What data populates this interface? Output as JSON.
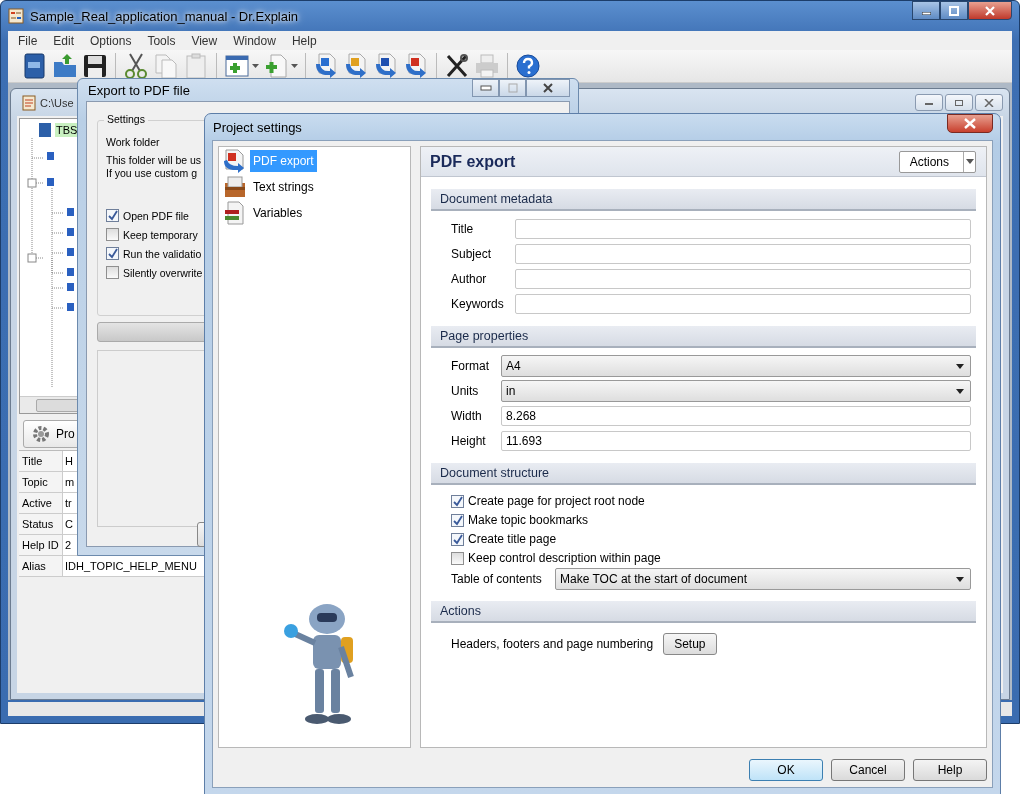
{
  "main_window": {
    "title": "Sample_Real_application_manual - Dr.Explain",
    "menu": [
      "File",
      "Edit",
      "Options",
      "Tools",
      "View",
      "Window",
      "Help"
    ]
  },
  "document_window": {
    "path": "C:\\Use",
    "tree_root": "TBS",
    "properties_button": "Pro",
    "properties": [
      {
        "name": "Title",
        "value": "H"
      },
      {
        "name": "Topic",
        "value": "m"
      },
      {
        "name": "Active",
        "value": "tr"
      },
      {
        "name": "Status",
        "value": "C"
      },
      {
        "name": "Help ID",
        "value": "2"
      },
      {
        "name": "Alias",
        "value": "IDH_TOPIC_HELP_MENU"
      }
    ]
  },
  "export_dialog": {
    "title": "Export to PDF file",
    "group": "Settings",
    "work_folder": "Work folder",
    "note_lines": [
      "This folder will be us",
      "If you use custom g"
    ],
    "options": [
      {
        "label": "Open PDF file",
        "checked": true
      },
      {
        "label": "Keep temporary",
        "checked": false
      },
      {
        "label": "Run the validatio",
        "checked": true
      },
      {
        "label": "Silently overwrite",
        "checked": false
      }
    ]
  },
  "project_settings": {
    "title": "Project settings",
    "nav": [
      {
        "label": "PDF export",
        "selected": true
      },
      {
        "label": "Text strings",
        "selected": false
      },
      {
        "label": "Variables",
        "selected": false
      }
    ],
    "heading": "PDF export",
    "actions_button": "Actions",
    "sections": [
      {
        "title": "Document metadata",
        "fields": [
          {
            "kind": "text",
            "label": "Title"
          },
          {
            "kind": "text",
            "label": "Subject"
          },
          {
            "kind": "text",
            "label": "Author"
          },
          {
            "kind": "text",
            "label": "Keywords"
          }
        ]
      },
      {
        "title": "Page properties",
        "fields": [
          {
            "kind": "select",
            "label": "Format",
            "value": "A4"
          },
          {
            "kind": "select",
            "label": "Units",
            "value": "in"
          },
          {
            "kind": "text",
            "label": "Width",
            "value": "8.268"
          },
          {
            "kind": "text",
            "label": "Height",
            "value": "11.693"
          }
        ]
      },
      {
        "title": "Document structure",
        "fields": [
          {
            "kind": "checkbox",
            "label": "Create page for project root node",
            "checked": true
          },
          {
            "kind": "checkbox",
            "label": "Make topic bookmarks",
            "checked": true
          },
          {
            "kind": "checkbox",
            "label": "Create title page",
            "checked": true
          },
          {
            "kind": "checkbox",
            "label": "Keep control description within page",
            "checked": false
          },
          {
            "kind": "select",
            "label": "Table of contents",
            "value": "Make TOC at the start of document"
          }
        ]
      },
      {
        "title": "Actions",
        "fields": [
          {
            "kind": "button",
            "label": "Headers, footers and page numbering",
            "button": "Setup"
          }
        ]
      }
    ],
    "buttons": [
      "OK",
      "Cancel",
      "Help"
    ]
  }
}
